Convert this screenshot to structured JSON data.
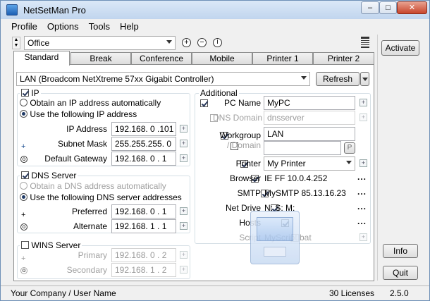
{
  "window": {
    "title": "NetSetMan Pro"
  },
  "menu": [
    "Profile",
    "Options",
    "Tools",
    "Help"
  ],
  "profile": {
    "selected": "Office"
  },
  "tabs": [
    "Standard",
    "Break",
    "Conference",
    "Mobile",
    "Printer 1",
    "Printer 2"
  ],
  "adapter": {
    "selected": "LAN (Broadcom NetXtreme 57xx Gigabit Controller)",
    "refresh": "Refresh"
  },
  "ip": {
    "title": "IP",
    "auto": "Obtain an IP address automatically",
    "manual": "Use the following IP address",
    "address_label": "IP Address",
    "address": "192.168. 0 .101",
    "mask_label": "Subnet Mask",
    "mask": "255.255.255. 0",
    "gateway_label": "Default Gateway",
    "gateway": "192.168. 0 . 1"
  },
  "dns": {
    "title": "DNS Server",
    "auto": "Obtain a DNS address automatically",
    "manual": "Use the following DNS server addresses",
    "preferred_label": "Preferred",
    "preferred": "192.168. 0 . 1",
    "alternate_label": "Alternate",
    "alternate": "192.168. 1 . 1"
  },
  "wins": {
    "title": "WINS Server",
    "primary_label": "Primary",
    "primary": "192.168. 0 . 2",
    "secondary_label": "Secondary",
    "secondary": "192.168. 1 . 2"
  },
  "additional": {
    "title": "Additional",
    "pc_name_label": "PC Name",
    "pc_name": "MyPC",
    "dns_domain_label": "DNS Domain",
    "dns_domain": "dnsserver",
    "workgroup_label": "Workgroup",
    "workgroup": "LAN",
    "domain_label": "/ Domain",
    "domain_p": "P",
    "printer_label": "Printer",
    "printer": "My Printer",
    "browser_label": "Browser",
    "browser": "IE FF 10.0.4.252",
    "smtp_label": "SMTP",
    "smtp": "MySMTP 85.13.16.23",
    "netdrive_label": "Net Drive",
    "netdrive": "N: S: M:",
    "hosts_label": "Hosts",
    "script_label": "Script",
    "script": "MyScript.bat",
    "dots": "..."
  },
  "side": {
    "activate": "Activate",
    "info": "Info",
    "quit": "Quit"
  },
  "status": {
    "company": "Your Company / User Name",
    "licenses": "30 Licenses",
    "version": "2.5.0"
  },
  "icons": {
    "plus": "+",
    "minus": "−",
    "info": "i",
    "small": "+",
    "menu": "≡"
  },
  "colors": {
    "title_bg": "#c1d5ee",
    "close": "#c8452b"
  }
}
